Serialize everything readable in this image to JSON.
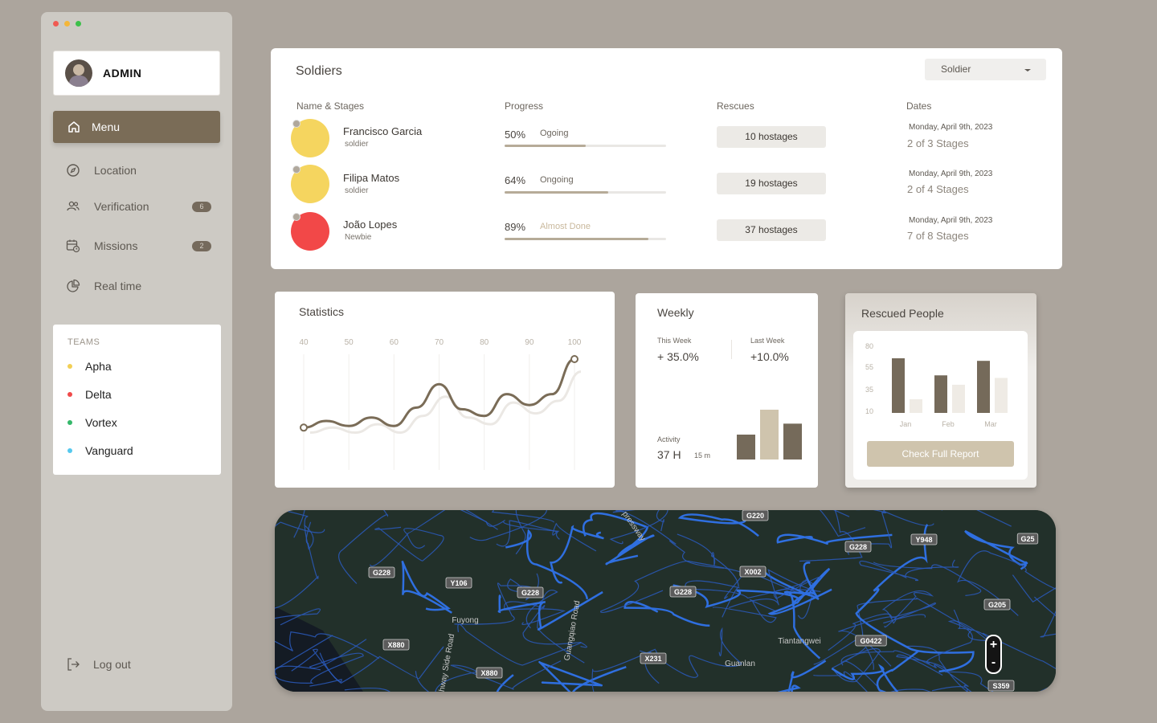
{
  "sidebar": {
    "admin": "ADMIN",
    "menu": "Menu",
    "items": [
      {
        "label": "Location",
        "icon": "compass-icon",
        "badge": ""
      },
      {
        "label": "Verification",
        "icon": "users-icon",
        "badge": "6"
      },
      {
        "label": "Missions",
        "icon": "calendar-clock-icon",
        "badge": "2"
      },
      {
        "label": "Real time",
        "icon": "pie-chart-icon",
        "badge": ""
      }
    ],
    "teams_title": "TEAMS",
    "teams": [
      {
        "name": "Apha",
        "color": "#f2cf55"
      },
      {
        "name": "Delta",
        "color": "#f04a4a"
      },
      {
        "name": "Vortex",
        "color": "#35b86a"
      },
      {
        "name": "Vanguard",
        "color": "#55c8ee"
      }
    ],
    "logout": "Log out"
  },
  "soldiers": {
    "title": "Soldiers",
    "filter": "Soldier",
    "headers": [
      "Name & Stages",
      "Progress",
      "Rescues",
      "Dates"
    ],
    "rows": [
      {
        "name": "Francisco Garcia",
        "role": "soldier",
        "color": "#f5d55f",
        "badge": "1",
        "pct": "50%",
        "progress": 0.5,
        "status": "Ogoing",
        "rescues": "10 hostages",
        "date": "Monday, April 9th, 2023",
        "stages": "2 of 3 Stages"
      },
      {
        "name": "Filipa Matos",
        "role": "soldier",
        "color": "#f5d55f",
        "badge": "1",
        "pct": "64%",
        "progress": 0.64,
        "status": "Ongoing",
        "rescues": "19 hostages",
        "date": "Monday, April 9th, 2023",
        "stages": "2 of 4 Stages"
      },
      {
        "name": "João Lopes",
        "role": "Newbie",
        "color": "#f24848",
        "badge": "2",
        "pct": "89%",
        "progress": 0.89,
        "status": "Almost Done",
        "rescues": "37 hostages",
        "date": "Monday, April 9th, 2023",
        "stages": "7 of 8  Stages"
      }
    ]
  },
  "statistics": {
    "title": "Statistics",
    "chart_data": {
      "type": "line",
      "x_ticks": [
        "40",
        "50",
        "60",
        "70",
        "80",
        "90",
        "100"
      ],
      "series": [
        {
          "values": [
            0.18,
            0.26,
            0.2,
            0.3,
            0.2,
            0.42,
            0.7,
            0.4,
            0.32,
            0.58,
            0.45,
            0.58,
            1.0
          ]
        },
        {
          "values": [
            0.12,
            0.18,
            0.12,
            0.22,
            0.12,
            0.32,
            0.55,
            0.3,
            0.22,
            0.48,
            0.35,
            0.5,
            0.85
          ]
        }
      ]
    }
  },
  "weekly": {
    "title": "Weekly",
    "this_week_label": "This Week",
    "this_week_value": "+ 35.0%",
    "last_week_label": "Last Week",
    "last_week_value": "+10.0%",
    "activity_label": "Activity",
    "activity_value": "37 H",
    "activity_sub": "15 m",
    "chart_data": {
      "type": "bar",
      "values": [
        0.5,
        1.0,
        0.72
      ],
      "colors": [
        "#756a5a",
        "#cfc4ad",
        "#756a5a"
      ]
    }
  },
  "rescued": {
    "title": "Rescued People",
    "button": "Check Full Report",
    "chart_data": {
      "type": "bar",
      "categories": [
        "Jan",
        "Feb",
        "Mar"
      ],
      "y_ticks": [
        "80",
        "55",
        "35",
        "10"
      ],
      "series": [
        {
          "values": [
            64,
            44,
            61
          ],
          "color": "#756a5a"
        },
        {
          "values": [
            16,
            33,
            41
          ],
          "color": "#efebe5"
        }
      ]
    }
  },
  "map": {
    "labels": [
      "G228",
      "Y106",
      "G228",
      "Fuyong",
      "X880",
      "X880",
      "G220",
      "X002",
      "G228",
      "G228",
      "Y948",
      "G25",
      "G205",
      "G0422",
      "Tiantangwei",
      "X231",
      "Guanlan",
      "S359",
      "Guangqiao Road",
      "hway Side Road",
      "pressway"
    ],
    "zoom_in": "+",
    "zoom_out": "-"
  }
}
